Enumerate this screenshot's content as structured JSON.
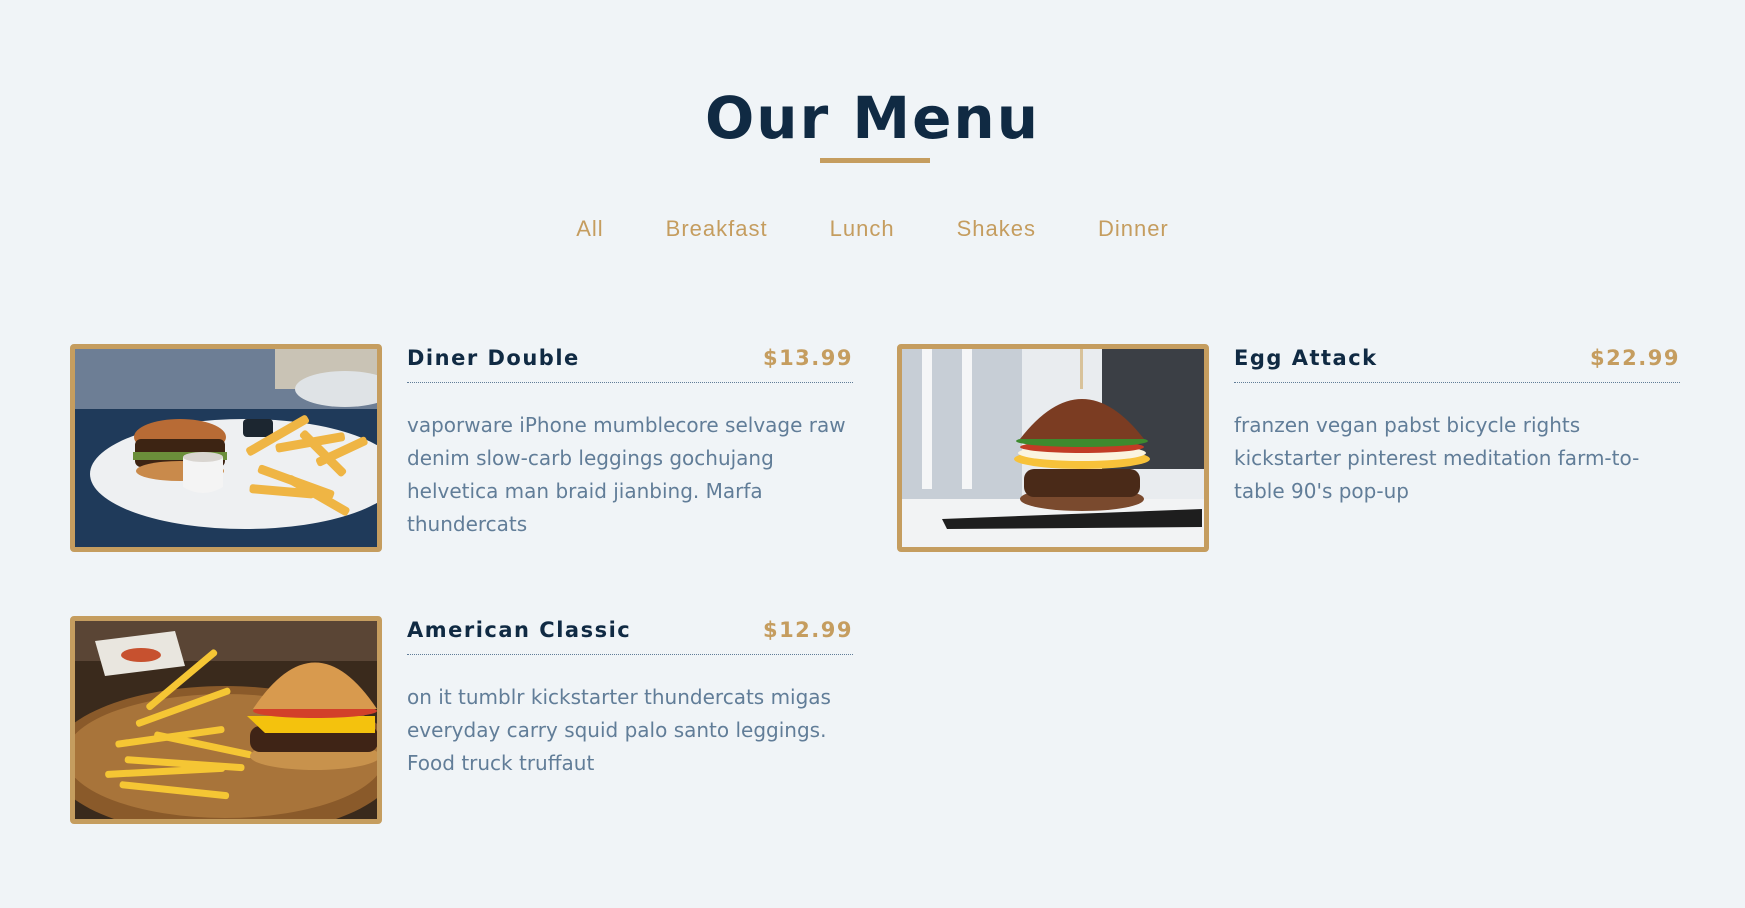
{
  "header": {
    "title": "Our Menu"
  },
  "filters": [
    "All",
    "Breakfast",
    "Lunch",
    "Shakes",
    "Dinner"
  ],
  "items": [
    {
      "name": "Diner Double",
      "price": "$13.99",
      "description": "vaporware iPhone mumblecore selvage raw denim slow-carb leggings gochujang helvetica man braid jianbing. Marfa thundercats"
    },
    {
      "name": "Egg Attack",
      "price": "$22.99",
      "description": "franzen vegan pabst bicycle rights kickstarter pinterest meditation farm-to-table 90's pop-up"
    },
    {
      "name": "American Classic",
      "price": "$12.99",
      "description": "on it tumblr kickstarter thundercats migas everyday carry squid palo santo leggings. Food truck truffaut"
    }
  ],
  "colors": {
    "accent": "#c59d5f",
    "heading": "#102a43",
    "body": "#617d98",
    "background": "#f0f4f7"
  }
}
